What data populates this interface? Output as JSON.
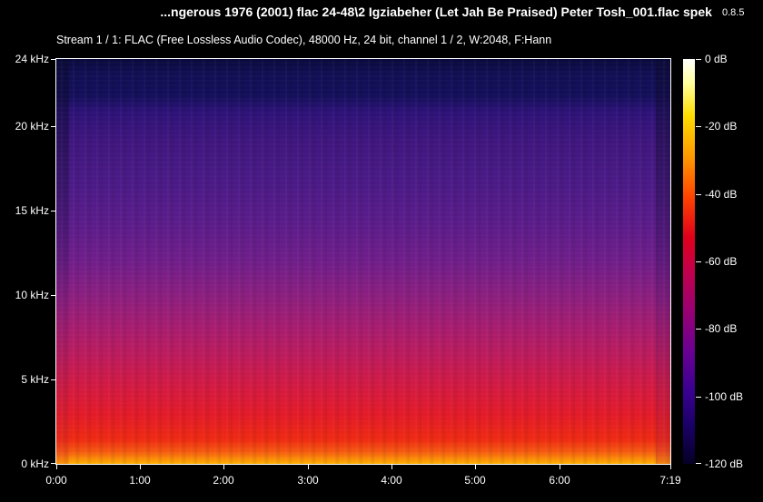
{
  "header": {
    "file_title": "...ngerous 1976 (2001) flac 24-48\\2 Igziabeher (Let Jah Be Praised) Peter Tosh_001.flac",
    "app_name": "spek",
    "app_version": "0.8.5",
    "stream_info": "Stream 1 / 1: FLAC (Free Lossless Audio Codec), 48000 Hz, 24 bit, channel 1 / 2, W:2048, F:Hann"
  },
  "frequency_axis": {
    "labels": [
      "24 kHz",
      "20 kHz",
      "15 kHz",
      "10 kHz",
      "5 kHz",
      "0 kHz"
    ]
  },
  "time_axis": {
    "labels": [
      "0:00",
      "1:00",
      "2:00",
      "3:00",
      "4:00",
      "5:00",
      "6:00",
      "7:19"
    ]
  },
  "db_scale": {
    "labels": [
      "0 dB",
      "-20 dB",
      "-40 dB",
      "-60 dB",
      "-80 dB",
      "-100 dB",
      "-120 dB"
    ]
  },
  "colors": {
    "background": "#000000",
    "text": "#ffffff",
    "scale_top": "#ffffff",
    "scale_mid": "#e0001a",
    "scale_bottom": "#050026"
  }
}
